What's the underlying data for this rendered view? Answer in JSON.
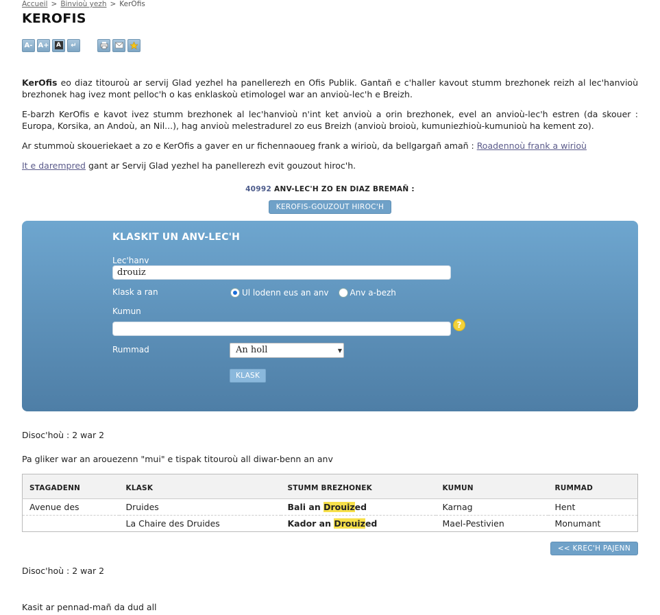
{
  "breadcrumb": {
    "items": [
      "Accueil",
      "Binvioù yezh",
      "KerOfis"
    ],
    "separator": ">"
  },
  "page_title": "KEROFIS",
  "toolbar": {
    "buttons": [
      {
        "label": "A-",
        "icon": "text-decrease-icon"
      },
      {
        "label": "A+",
        "icon": "text-increase-icon"
      },
      {
        "label": "A",
        "icon": "contrast-icon"
      },
      {
        "label": "↵",
        "icon": "return-icon"
      },
      {
        "label": "",
        "icon": "print-icon"
      },
      {
        "label": "",
        "icon": "mail-icon"
      },
      {
        "label": "",
        "icon": "favorite-star-icon"
      }
    ]
  },
  "intro": {
    "p1_bold": "KerOfis",
    "p1_rest": " eo diaz titouroù ar servij Glad yezhel ha panellerezh en Ofis Publik. Gantañ e c'haller kavout stumm brezhonek reizh al lec'hanvioù brezhonek hag ivez mont pelloc'h o kas enklaskoù etimologel war an anvioù-lec'h e Breizh.",
    "p2": "E-barzh KerOfis e kavot ivez stumm brezhonek al lec'hanvioù n'int ket anvioù a orin brezhonek, evel an anvioù-lec'h estren (da skouer : Europa, Korsika, an Andoù, an Nil...), hag anvioù melestradurel zo eus Breizh (anvioù broioù, kumuniezhioù-kumunioù ha kement zo).",
    "p3_text": "Ar stummoù skoueriekaet a zo e KerOfis a gaver en ur fichennaoueg frank a wirioù, da bellgargañ amañ : ",
    "p3_link": "Roadennoù frank a wirioù",
    "p4_link": "It e darempred",
    "p4_text": " gant ar Servij Glad yezhel ha panellerezh evit gouzout hiroc'h."
  },
  "count": {
    "number": "40992",
    "text": " ANV-LEC'H ZO EN DIAZ BREMAÑ :"
  },
  "advanced_button": "KEROFIS-GOUZOUT HIROC'H",
  "search": {
    "title": "KLASKIT UN ANV-LEC'H",
    "placename_label": "Lec'hanv",
    "placename_value": "drouiz",
    "scope_label": "Klask a ran",
    "radio_option_1": "Ul lodenn eus an anv",
    "radio_option_2": "Anv a-bezh",
    "commune_label": "Kumun",
    "commune_value": "",
    "category_label": "Rummad",
    "category_selected": "An holl",
    "submit_label": "KLASK",
    "help_label": "?"
  },
  "results_count_top": "Disoc'hoù : 2 war 2",
  "hint": "Pa gliker war an arouezenn \"mui\" e tispak titouroù all diwar-benn an anv",
  "table": {
    "headers": [
      "STAGADENN",
      "KLASK",
      "STUMM BREZHONEK",
      "KUMUN",
      "RUMMAD"
    ],
    "rows": [
      {
        "stagadenn": "Avenue des",
        "klask": "Druides",
        "stumm_pre": "Bali an ",
        "stumm_hl": "Drouiz",
        "stumm_post": "ed",
        "kumun": "Karnag",
        "rummad": "Hent"
      },
      {
        "stagadenn": "",
        "klask": "La Chaire des Druides",
        "stumm_pre": "Kador an ",
        "stumm_hl": "Drouiz",
        "stumm_post": "ed",
        "kumun": "Mael-Pestivien",
        "rummad": "Monumant"
      }
    ]
  },
  "prev_page": "<<  KREC'H PAJENN",
  "results_count_bottom": "Disoc'hoù : 2 war 2",
  "reviews": "Kasit ar pennad-mañ da dud all",
  "colors": {
    "panel_top": "#6ea6cf",
    "panel_bottom": "#4e7ea6",
    "button": "#6fa1c8",
    "highlight": "#f7e04a"
  }
}
